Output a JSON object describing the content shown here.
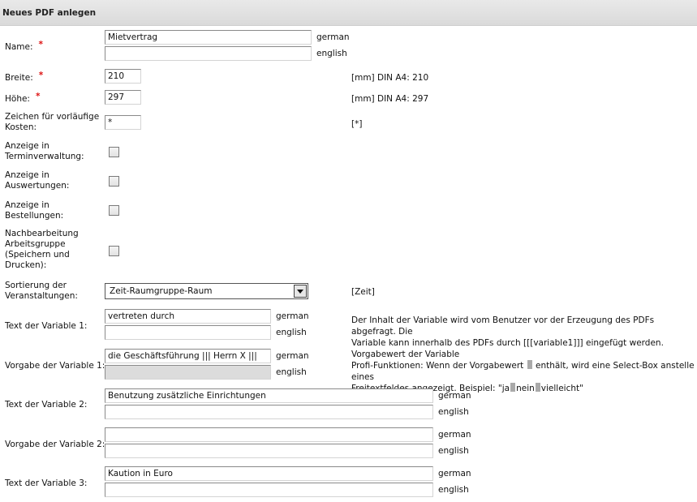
{
  "header": {
    "title": "Neues PDF anlegen"
  },
  "languages": {
    "german": "german",
    "english": "english"
  },
  "name": {
    "label": "Name:",
    "required": "*",
    "value_de": "Mietvertrag",
    "value_en": ""
  },
  "breite": {
    "label": "Breite:",
    "required": "*",
    "value": "210",
    "hint": "[mm] DIN A4: 210"
  },
  "hoehe": {
    "label": "Höhe:",
    "required": "*",
    "value": "297",
    "hint": "[mm] DIN A4: 297"
  },
  "zeichen": {
    "label_line1": "Zeichen für vorläufige",
    "label_line2": "Kosten:",
    "value": "*",
    "hint": "[*]"
  },
  "anzeige_termin": {
    "label_line1": "Anzeige in",
    "label_line2": "Terminverwaltung:",
    "checked": false
  },
  "anzeige_auswertungen": {
    "label_line1": "Anzeige in",
    "label_line2": "Auswertungen:",
    "checked": false
  },
  "anzeige_bestellungen": {
    "label_line1": "Anzeige in",
    "label_line2": "Bestellungen:",
    "checked": false
  },
  "nachbearbeitung": {
    "label_line1": "Nachbearbeitung",
    "label_line2": "Arbeitsgruppe",
    "label_line3": "(Speichern und",
    "label_line4": "Drucken):",
    "checked": false
  },
  "sortierung": {
    "label_line1": "Sortierung der",
    "label_line2": "Veranstaltungen:",
    "selected": "Zeit-Raumgruppe-Raum",
    "hint": "[Zeit]"
  },
  "text_var1": {
    "label": "Text der Variable 1:",
    "value_de": "vertreten durch",
    "value_en": "",
    "hint_line1": "Der Inhalt der Variable wird vom Benutzer vor der Erzeugung des PDFs abgefragt. Die",
    "hint_line2": "Variable kann innerhalb des PDFs durch [[[variable1]]] eingefügt werden."
  },
  "vorgabe_var1": {
    "label": "Vorgabe der Variable 1:",
    "value_de": "die Geschäftsführung ||| Herrn X |||",
    "value_en": "",
    "hint_line1": "Vorgabewert der Variable",
    "hint_line2a": "Profi-Funktionen: Wenn der Vorgabewert",
    "hint_line2b": "enthält, wird eine Select-Box anstelle eines",
    "hint_line3a": "Freitextfeldes angezeigt. Beispiel: \"ja",
    "hint_line3b": "nein",
    "hint_line3c": "vielleicht\""
  },
  "text_var2": {
    "label": "Text der Variable 2:",
    "value_de": "Benutzung zusätzliche Einrichtungen",
    "value_en": ""
  },
  "vorgabe_var2": {
    "label": "Vorgabe der Variable 2:",
    "value_de": "",
    "value_en": ""
  },
  "text_var3": {
    "label": "Text der Variable 3:",
    "value_de": "Kaution in Euro",
    "value_en": ""
  }
}
